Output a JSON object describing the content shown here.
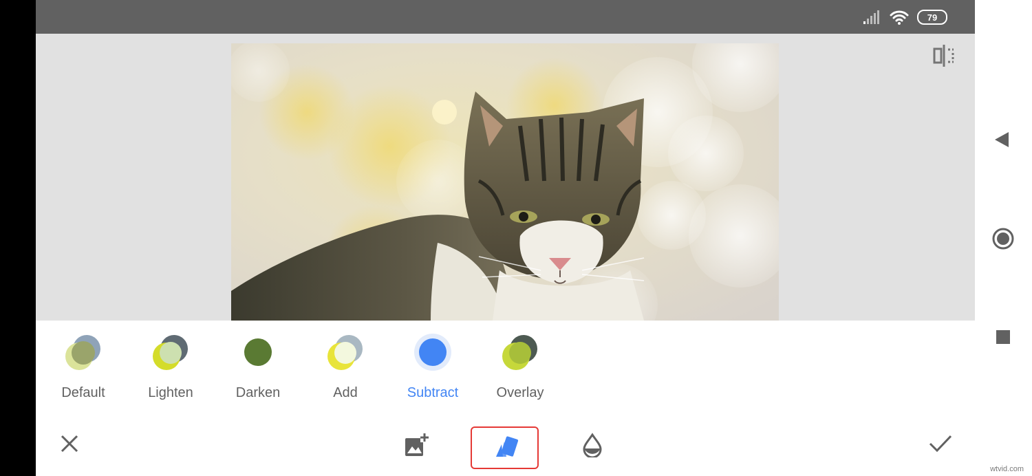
{
  "status_bar": {
    "battery": "79",
    "icons": [
      "signal-icon",
      "wifi-icon",
      "battery-icon"
    ]
  },
  "canvas": {
    "photo": "cat-photo",
    "compare_icon": "compare-split-icon"
  },
  "blend_modes": {
    "selected": "Subtract",
    "items": [
      {
        "label": "Default"
      },
      {
        "label": "Lighten"
      },
      {
        "label": "Darken"
      },
      {
        "label": "Add"
      },
      {
        "label": "Subtract"
      },
      {
        "label": "Overlay"
      }
    ]
  },
  "toolbar": {
    "icons": [
      "close-icon",
      "add-image-icon",
      "blend-mode-icon",
      "opacity-drop-icon",
      "check-icon"
    ]
  },
  "nav": {
    "icons": [
      "back-icon",
      "home-icon",
      "recents-icon"
    ]
  },
  "watermark": "wtvid.com",
  "colors": {
    "accent": "#4285f4",
    "status_bar": "#616161",
    "canvas_bg": "#e1e1e1",
    "highlight_frame": "#e53935"
  }
}
